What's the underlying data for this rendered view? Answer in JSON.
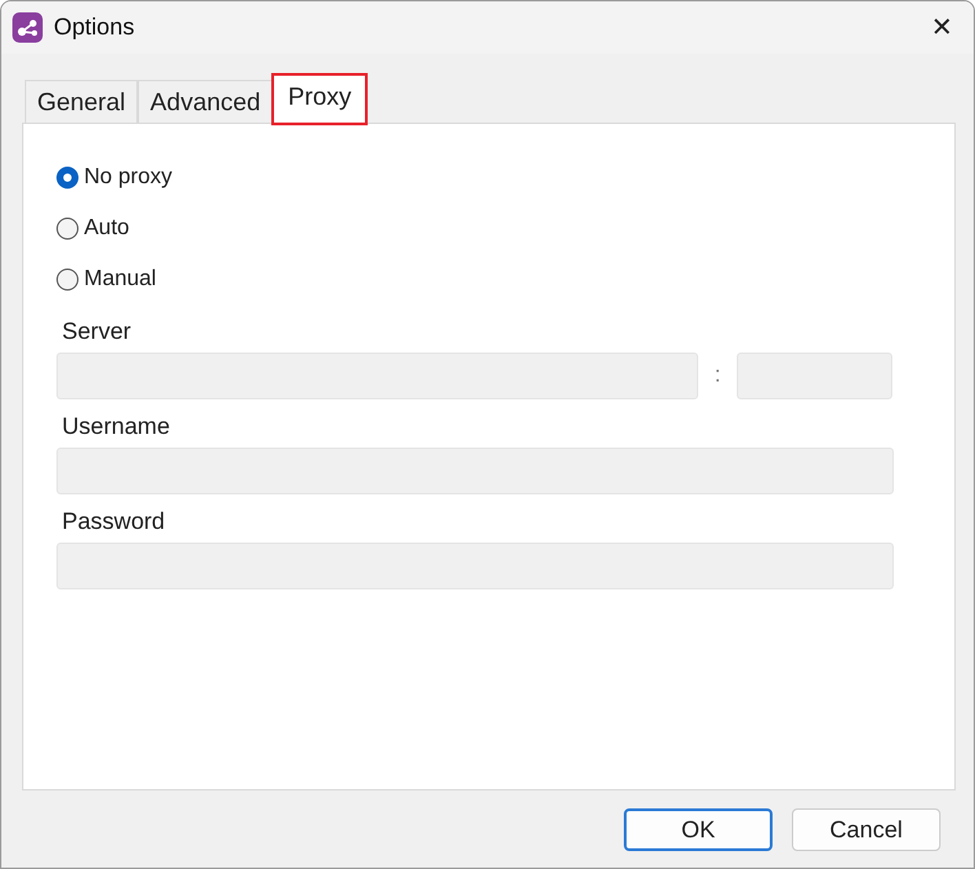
{
  "window": {
    "title": "Options",
    "close": "✕"
  },
  "tabs": [
    {
      "label": "General",
      "selected": false,
      "highlighted": false
    },
    {
      "label": "Advanced",
      "selected": false,
      "highlighted": false
    },
    {
      "label": "Proxy",
      "selected": true,
      "highlighted": true
    }
  ],
  "proxy_modes": [
    {
      "label": "No proxy",
      "selected": true
    },
    {
      "label": "Auto",
      "selected": false
    },
    {
      "label": "Manual",
      "selected": false
    }
  ],
  "server": {
    "label": "Server",
    "separator": ":",
    "disabled": true
  },
  "fields": [
    {
      "label": "Username",
      "disabled": true
    },
    {
      "label": "Password",
      "disabled": true
    }
  ],
  "buttons": [
    {
      "label": "OK",
      "default": true
    },
    {
      "label": "Cancel",
      "default": false
    }
  ]
}
